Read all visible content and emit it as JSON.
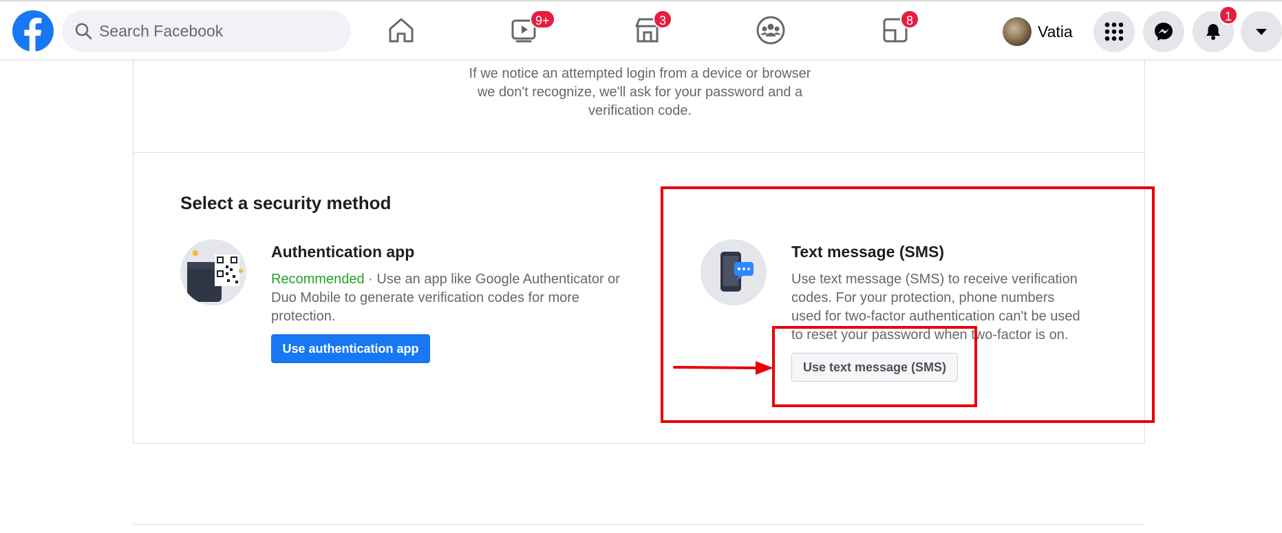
{
  "header": {
    "search_placeholder": "Search Facebook",
    "user_name": "Vatia",
    "badges": {
      "watch": "9+",
      "marketplace": "3",
      "gaming": "8",
      "notifications": "1"
    },
    "icons": [
      "facebook-logo",
      "search-icon",
      "home-icon",
      "watch-icon",
      "marketplace-icon",
      "groups-icon",
      "gaming-icon",
      "menu-grid-icon",
      "messenger-icon",
      "bell-icon",
      "caret-down-icon"
    ]
  },
  "intro": {
    "lines": [
      "If we notice an attempted login from a device or browser",
      "we don't recognize, we'll ask for your password and a",
      "verification code."
    ]
  },
  "security": {
    "title": "Select a security method",
    "auth_app": {
      "title": "Authentication app",
      "recommended": "Recommended",
      "separator": " · ",
      "lines": [
        "Use an app like Google Authenticator or",
        "Duo Mobile to generate verification codes for more",
        "protection."
      ],
      "button": "Use authentication app"
    },
    "sms": {
      "title": "Text message (SMS)",
      "lines": [
        "Use text message (SMS) to receive verification",
        "codes. For your protection, phone numbers",
        "used for two-factor authentication can't be used",
        "to reset your password when two-factor is on."
      ],
      "button": "Use text message (SMS)"
    }
  },
  "colors": {
    "primary": "#1877f2",
    "annotation": "#e8000b",
    "badge": "#e41e3f",
    "recommended": "#23a127"
  }
}
